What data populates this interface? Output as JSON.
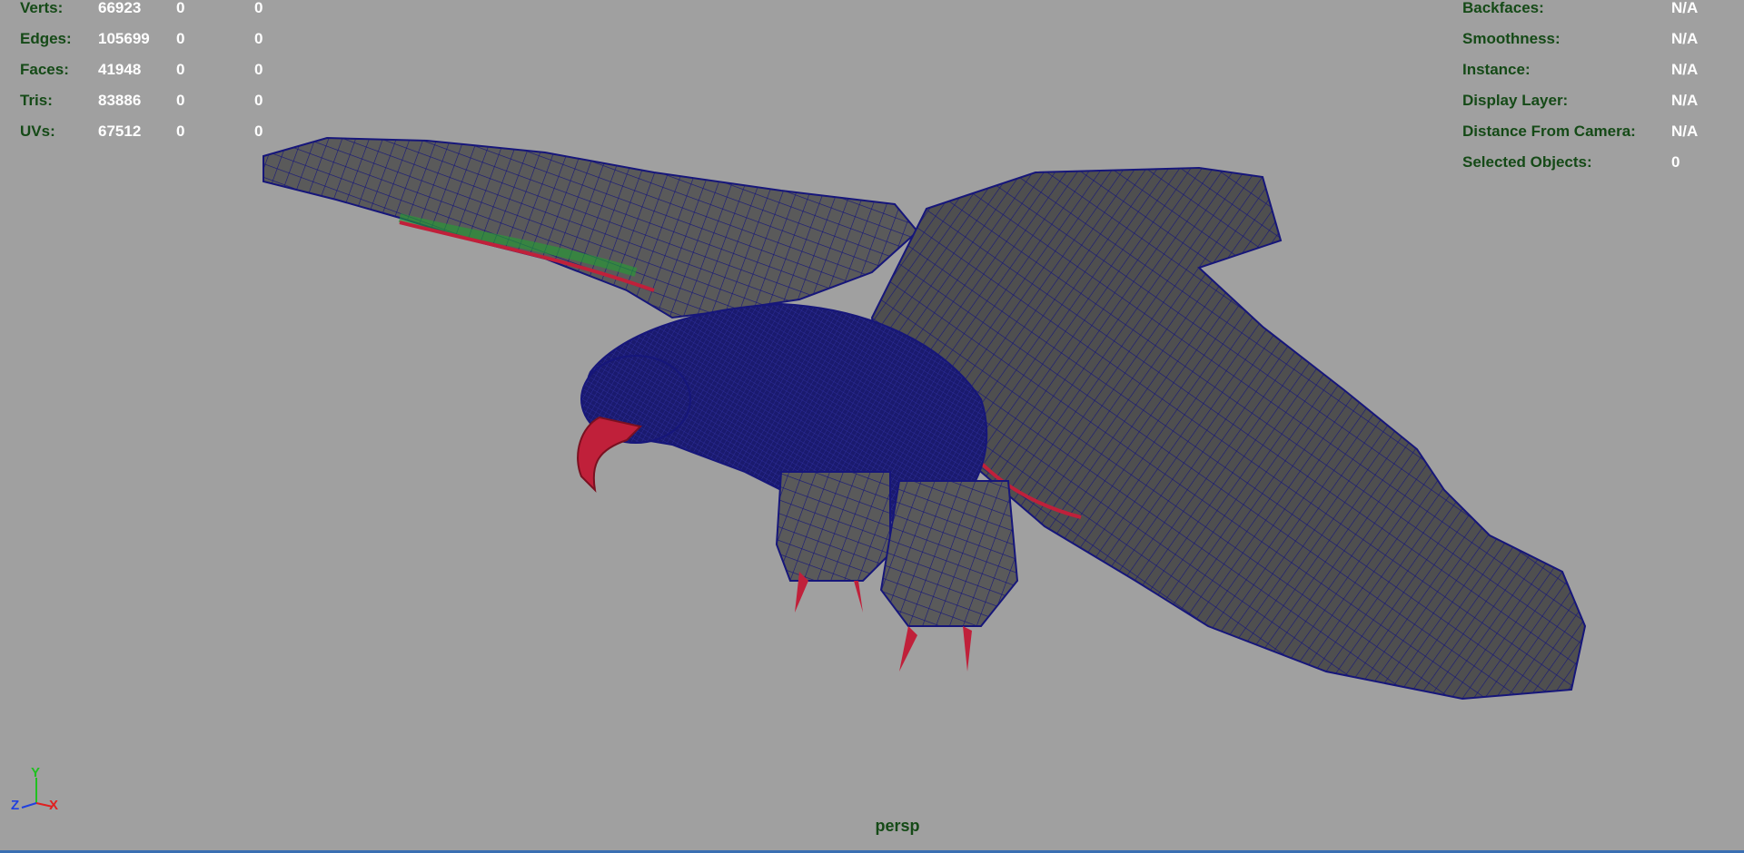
{
  "viewport": {
    "camera": "persp",
    "accent_colors": {
      "hud_label": "#154a17",
      "hud_value": "#ffffff",
      "background": "#a0a0a0",
      "wire": "#1a1a80",
      "beak": "#c0203a"
    }
  },
  "stats_left": [
    {
      "label": "Verts:",
      "v1": "66923",
      "v2": "0",
      "v3": "0"
    },
    {
      "label": "Edges:",
      "v1": "105699",
      "v2": "0",
      "v3": "0"
    },
    {
      "label": "Faces:",
      "v1": "41948",
      "v2": "0",
      "v3": "0"
    },
    {
      "label": "Tris:",
      "v1": "83886",
      "v2": "0",
      "v3": "0"
    },
    {
      "label": "UVs:",
      "v1": "67512",
      "v2": "0",
      "v3": "0"
    }
  ],
  "stats_right": [
    {
      "label": "Backfaces:",
      "value": "N/A"
    },
    {
      "label": "Smoothness:",
      "value": "N/A"
    },
    {
      "label": "Instance:",
      "value": "N/A"
    },
    {
      "label": "Display Layer:",
      "value": "N/A"
    },
    {
      "label": "Distance From Camera:",
      "value": "N/A"
    },
    {
      "label": "Selected Objects:",
      "value": "0"
    }
  ],
  "axis": {
    "y": "Y",
    "z": "Z",
    "x": "X"
  },
  "model": {
    "icon": "eagle-mesh-wireframe"
  }
}
